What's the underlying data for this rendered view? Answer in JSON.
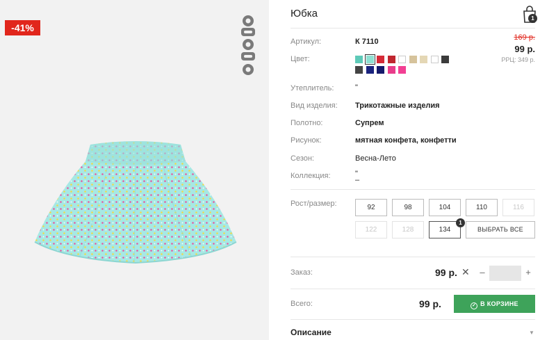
{
  "badge": {
    "discount": "-41%"
  },
  "product": {
    "title": "Юбка",
    "cart_count": "1"
  },
  "pricing": {
    "old_price": "169 р.",
    "new_price": "99 р.",
    "rrc": "PPЦ: 349 р."
  },
  "attributes": [
    {
      "label": "Артикул:",
      "value": "К 7110"
    },
    {
      "label": "Цвет:",
      "value": ""
    },
    {
      "label": "Утеплитель:",
      "value": "\""
    },
    {
      "label": "Вид изделия:",
      "value": "Трикотажные изделия"
    },
    {
      "label": "Полотно:",
      "value": "Супрем"
    },
    {
      "label": "Рисунок:",
      "value": "мятная конфета, конфетти"
    },
    {
      "label": "Сезон:",
      "value": "Весна-Лето"
    },
    {
      "label": "Коллекция:",
      "value": "\""
    },
    {
      "label": "",
      "value": "–"
    }
  ],
  "colors": {
    "row1": [
      "#5ecab8",
      "#8fe0d2",
      "#d62b38",
      "#c0262f",
      "#ffffff",
      "#d6c39c",
      "#e4d7b5",
      "#ffffff",
      "#3b3b3b"
    ],
    "row2": [
      "#444444",
      "#1a237e",
      "#151a6b",
      "#e83c8a",
      "#f23f93"
    ],
    "selected_index": 1
  },
  "sizes": {
    "label": "Рост/размер:",
    "items": [
      {
        "label": "92",
        "state": "available"
      },
      {
        "label": "98",
        "state": "available"
      },
      {
        "label": "104",
        "state": "available"
      },
      {
        "label": "110",
        "state": "available"
      },
      {
        "label": "116",
        "state": "disabled"
      },
      {
        "label": "122",
        "state": "disabled"
      },
      {
        "label": "128",
        "state": "disabled"
      },
      {
        "label": "134",
        "state": "selected"
      }
    ],
    "selected_badge": "1",
    "select_all": "ВЫБРАТЬ ВСЕ"
  },
  "order": {
    "label": "Заказ:",
    "price": "99 р.",
    "times": "✕",
    "minus": "–",
    "plus": "+",
    "quantity": ""
  },
  "total": {
    "label": "Всего:",
    "price": "99 р.",
    "button": "В КОРЗИНЕ",
    "check": "✓"
  },
  "description": {
    "title": "Описание",
    "arrow": "▼"
  }
}
